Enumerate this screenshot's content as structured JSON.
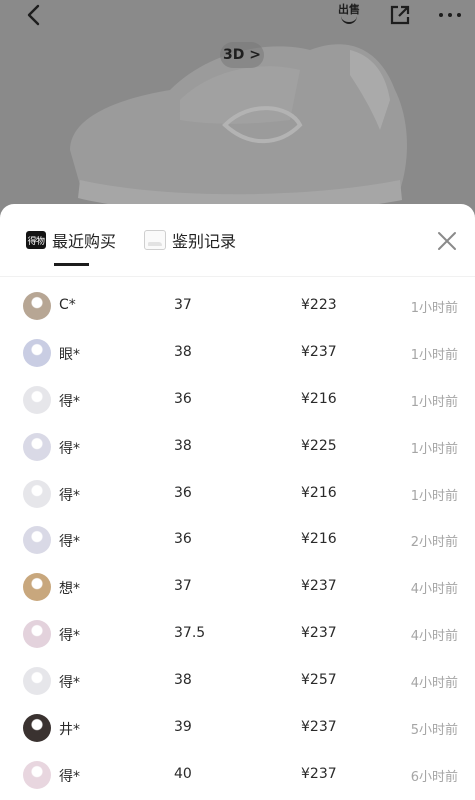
{
  "header": {
    "sell_label": "出售",
    "badge_3d": "3D >",
    "icons": [
      "back-arrow-icon",
      "sell-icon",
      "share-icon",
      "more-icon"
    ]
  },
  "tabs": [
    {
      "label": "最近购买",
      "logo_text": "得物",
      "active": true
    },
    {
      "label": "鉴别记录",
      "active": false
    }
  ],
  "colors": {
    "text": "#222222",
    "muted": "#a5a5a5",
    "overlay": "#7f7f7f",
    "sheet": "#ffffff"
  },
  "records": [
    {
      "name": "C*",
      "size": "37",
      "price": "¥223",
      "time": "1小时前",
      "avatar_color": "#b7a694"
    },
    {
      "name": "眼*",
      "size": "38",
      "price": "¥237",
      "time": "1小时前",
      "avatar_color": "#c9cde3"
    },
    {
      "name": "得*",
      "size": "36",
      "price": "¥216",
      "time": "1小时前",
      "avatar_color": "#e6e6ea"
    },
    {
      "name": "得*",
      "size": "38",
      "price": "¥225",
      "time": "1小时前",
      "avatar_color": "#d9d9e6"
    },
    {
      "name": "得*",
      "size": "36",
      "price": "¥216",
      "time": "1小时前",
      "avatar_color": "#e6e6ea"
    },
    {
      "name": "得*",
      "size": "36",
      "price": "¥216",
      "time": "2小时前",
      "avatar_color": "#d9d9e6"
    },
    {
      "name": "想*",
      "size": "37",
      "price": "¥237",
      "time": "4小时前",
      "avatar_color": "#c8a77d"
    },
    {
      "name": "得*",
      "size": "37.5",
      "price": "¥237",
      "time": "4小时前",
      "avatar_color": "#e3d2dc"
    },
    {
      "name": "得*",
      "size": "38",
      "price": "¥257",
      "time": "4小时前",
      "avatar_color": "#e6e6ea"
    },
    {
      "name": "井*",
      "size": "39",
      "price": "¥237",
      "time": "5小时前",
      "avatar_color": "#3a3230"
    },
    {
      "name": "得*",
      "size": "40",
      "price": "¥237",
      "time": "6小时前",
      "avatar_color": "#e8d6df"
    }
  ]
}
